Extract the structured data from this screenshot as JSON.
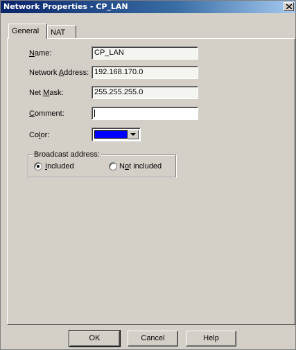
{
  "window": {
    "title": "Network Properties - CP_LAN"
  },
  "tabs": [
    {
      "label": "General",
      "active": true
    },
    {
      "label": "NAT",
      "active": false
    }
  ],
  "form": {
    "name": {
      "label_u": "N",
      "label_rest": "ame:",
      "value": "CP_LAN"
    },
    "address": {
      "label_pre": "Network ",
      "label_u": "A",
      "label_rest": "ddress:",
      "value": "192.168.170.0"
    },
    "mask": {
      "label_pre": "Net ",
      "label_u": "M",
      "label_rest": "ask:",
      "value": "255.255.255.0"
    },
    "comment": {
      "label_u": "C",
      "label_rest": "omment:",
      "value": ""
    },
    "color": {
      "label_pre": "Co",
      "label_u": "l",
      "label_rest": "or:",
      "value": "#0000ff"
    }
  },
  "broadcast": {
    "title": "Broadcast address:",
    "included": {
      "label_u": "I",
      "label_rest": "ncluded",
      "selected": true
    },
    "not_included": {
      "label_pre": "N",
      "label_u": "o",
      "label_rest": "t included",
      "selected": false
    }
  },
  "buttons": {
    "ok": "OK",
    "cancel": "Cancel",
    "help": "Help"
  },
  "colors": {
    "title_bar": "#0a246a",
    "face": "#d4d0c8",
    "swatch": "#0000ff"
  }
}
